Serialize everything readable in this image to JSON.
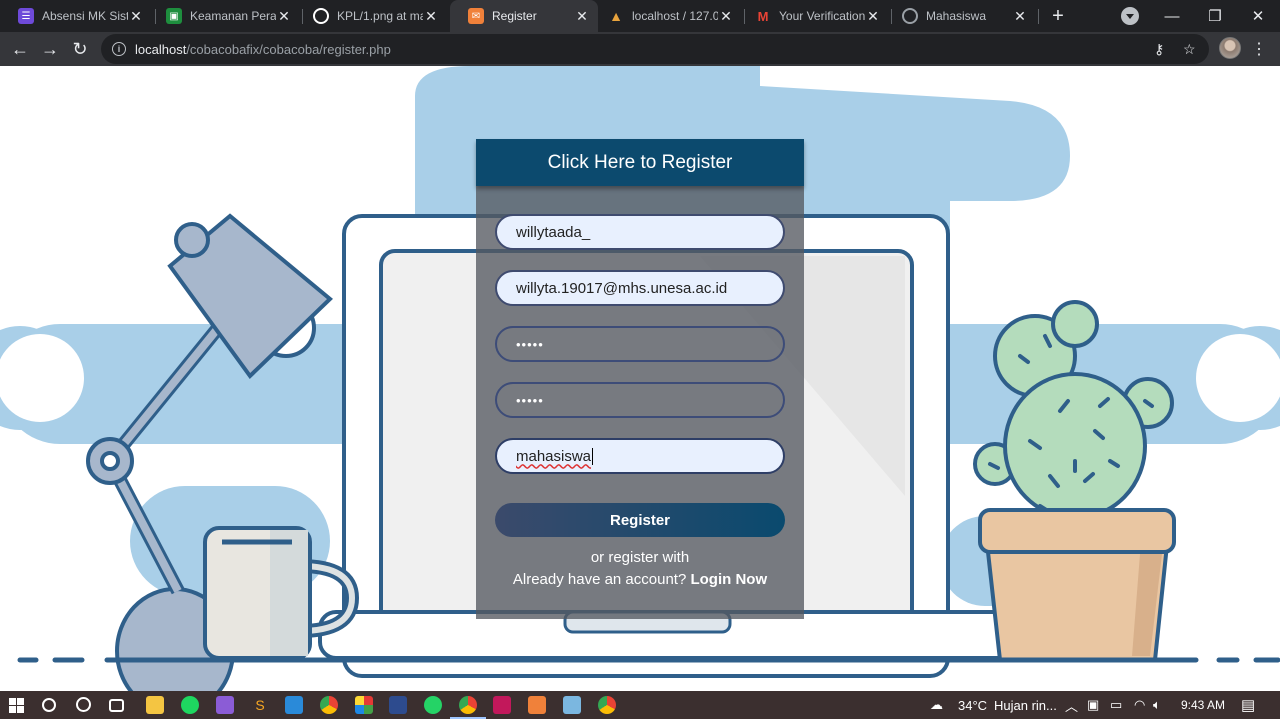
{
  "browser": {
    "tabs": [
      {
        "title": "Absensi MK Sistem",
        "favicon_color": "#6e4ad9",
        "favicon_glyph": "☰",
        "active": false
      },
      {
        "title": "Keamanan Perangkat",
        "favicon_color": "#1e8e3e",
        "favicon_glyph": "▣",
        "active": false
      },
      {
        "title": "KPL/1.png at main",
        "favicon_color": "#ffffff",
        "favicon_glyph": "●",
        "active": false
      },
      {
        "title": "Register",
        "favicon_color": "#f0813a",
        "favicon_glyph": "✉",
        "active": true
      },
      {
        "title": "localhost / 127.0.0.1",
        "favicon_color": "#e8a33d",
        "favicon_glyph": "▲",
        "active": false
      },
      {
        "title": "Your Verification",
        "favicon_color": "#ea4335",
        "favicon_glyph": "M",
        "active": false
      },
      {
        "title": "Mahasiswa",
        "favicon_color": "#9aa0a6",
        "favicon_glyph": "◎",
        "active": false
      }
    ],
    "url_host": "localhost",
    "url_path": "/cobacobafix/cobacoba/register.php"
  },
  "register": {
    "header": "Click Here to Register",
    "username_value": "willytaada_",
    "email_value": "willyta.19017@mhs.unesa.ac.id",
    "password_mask": "•••••",
    "confirm_mask": "•••••",
    "role_value": "mahasiswa",
    "submit_label": "Register",
    "alt_text": "or register with",
    "login_prompt": "Already have an account?",
    "login_link": "Login Now"
  },
  "taskbar": {
    "weather_temp": "34°C",
    "weather_text": "Hujan rin...",
    "clock": "9:43 AM"
  },
  "colors": {
    "card_header": "#0c4a6e",
    "sky_blue": "#a9cfe8",
    "outline": "#2f5f8a",
    "cactus": "#b4dcbc",
    "pot": "#e9c6a2"
  }
}
